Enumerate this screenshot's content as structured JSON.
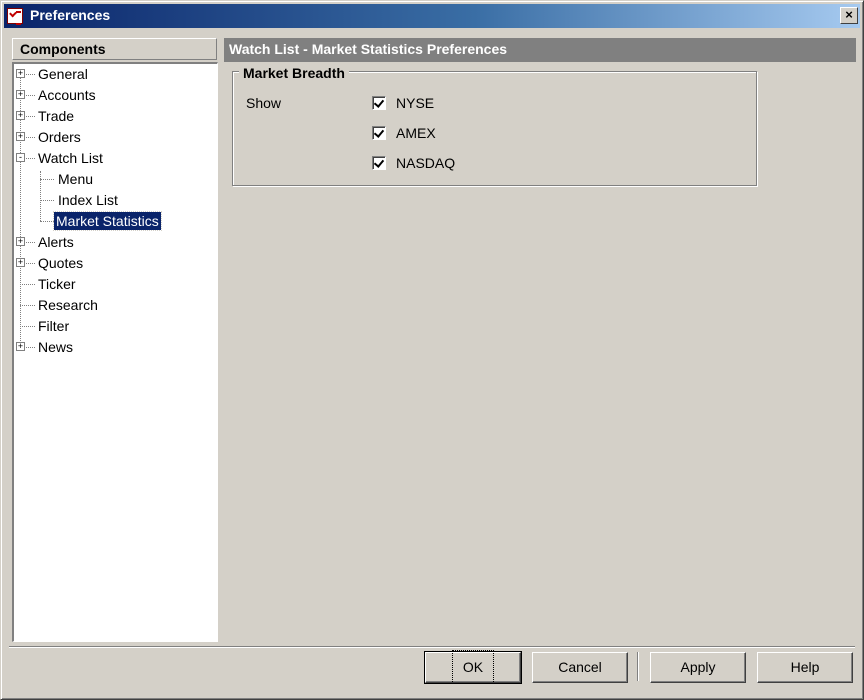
{
  "window": {
    "title": "Preferences",
    "close_glyph": "×"
  },
  "sidebar": {
    "header": "Components",
    "items": [
      {
        "label": "General",
        "expander": "+"
      },
      {
        "label": "Accounts",
        "expander": "+"
      },
      {
        "label": "Trade",
        "expander": "+"
      },
      {
        "label": "Orders",
        "expander": "+"
      },
      {
        "label": "Watch List",
        "expander": "-"
      },
      {
        "label": "Menu"
      },
      {
        "label": "Index List"
      },
      {
        "label": "Market Statistics",
        "selected": true
      },
      {
        "label": "Alerts",
        "expander": "+"
      },
      {
        "label": "Quotes",
        "expander": "+"
      },
      {
        "label": "Ticker"
      },
      {
        "label": "Research"
      },
      {
        "label": "Filter"
      },
      {
        "label": "News",
        "expander": "+"
      }
    ]
  },
  "main": {
    "header": "Watch List - Market Statistics Preferences",
    "group_title": "Market Breadth",
    "show_label": "Show",
    "checkboxes": [
      {
        "label": "NYSE",
        "checked": true
      },
      {
        "label": "AMEX",
        "checked": true
      },
      {
        "label": "NASDAQ",
        "checked": true
      }
    ]
  },
  "buttons": {
    "ok": "OK",
    "cancel": "Cancel",
    "apply": "Apply",
    "help": "Help"
  }
}
